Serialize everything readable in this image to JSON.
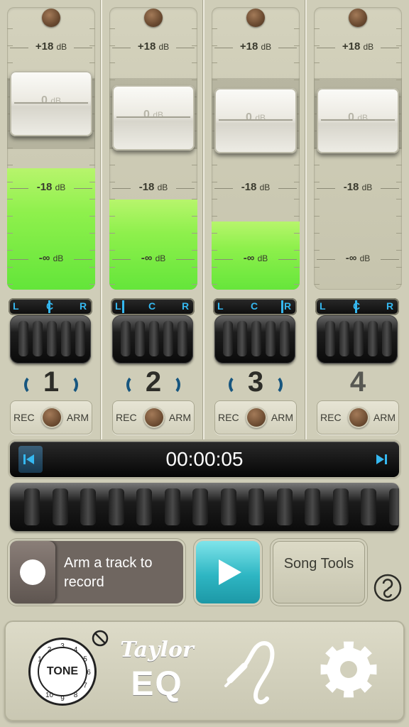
{
  "mixer": {
    "scale": {
      "top": "+18",
      "zero": "0",
      "minus18": "-18",
      "inf": "-∞",
      "unit": "dB"
    },
    "pan_labels": {
      "l": "L",
      "c": "C",
      "r": "R"
    },
    "rec_label": "REC",
    "arm_label": "ARM",
    "channels": [
      {
        "number": "1",
        "armed": true,
        "level": 0.43,
        "pan": 0.5
      },
      {
        "number": "2",
        "armed": true,
        "level": 0.32,
        "pan": 0.0
      },
      {
        "number": "3",
        "armed": true,
        "level": 0.24,
        "pan": 1.0
      },
      {
        "number": "4",
        "armed": false,
        "level": 0.0,
        "pan": 0.5
      }
    ]
  },
  "transport": {
    "time": "00:00:05",
    "rewind_icon": "skip-to-start-icon",
    "end_icon": "skip-to-end-icon"
  },
  "controls": {
    "arm_prompt": "Arm a track to record",
    "play_icon": "play-icon",
    "song_tools": "Song Tools",
    "help_icon": "help-icon"
  },
  "bottom_bar": {
    "tone_label": "TONE",
    "tone_numbers": [
      "1",
      "2",
      "3",
      "4",
      "5",
      "6",
      "7",
      "8",
      "9",
      "10"
    ],
    "taylor_brand": "Taylor",
    "eq_label": "EQ",
    "cable_icon": "instrument-cable-icon",
    "settings_icon": "gear-icon"
  },
  "colors": {
    "meter_green": "#8ef04c",
    "pan_blue": "#35b8f0",
    "play_teal": "#2eb6c3",
    "panel": "#cfcdb8"
  }
}
